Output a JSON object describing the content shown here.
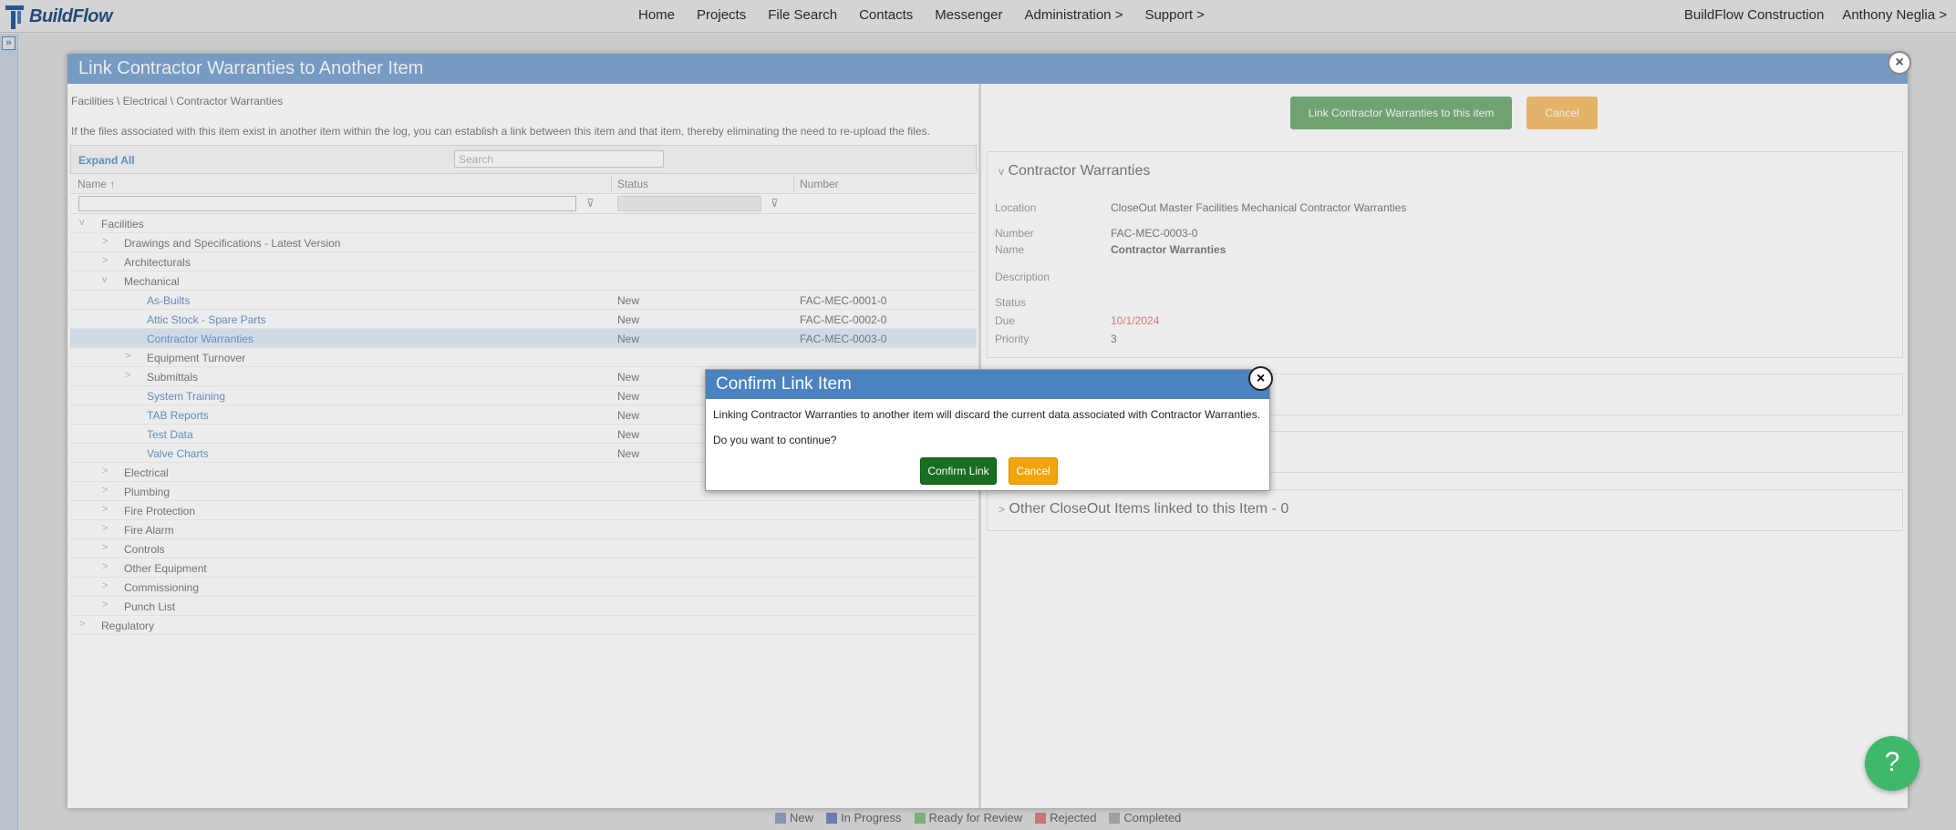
{
  "app": {
    "logo": "BuildFlow"
  },
  "nav": {
    "items": [
      "Home",
      "Projects",
      "File Search",
      "Contacts",
      "Messenger",
      "Administration >",
      "Support >"
    ],
    "company": "BuildFlow Construction",
    "user": "Anthony Neglia >"
  },
  "rail": {
    "toggle": "»"
  },
  "legend": [
    "New",
    "In Progress",
    "Ready for Review",
    "Rejected",
    "Completed"
  ],
  "link_modal": {
    "title": "Link Contractor Warranties to Another Item",
    "close": "×",
    "breadcrumb": "Facilities \\ Electrical \\ Contractor Warranties",
    "info": "If the files associated with this item exist in another item within the log, you can establish a link between this item and that item, thereby eliminating the need to re-upload the files.",
    "expand_all": "Expand All",
    "search_placeholder": "Search",
    "columns": {
      "name": "Name",
      "sort": "↑",
      "status": "Status",
      "number": "Number"
    },
    "filter_icon": "⊽",
    "rows": [
      {
        "chev": "v",
        "name": "Facilities",
        "status": "",
        "number": "",
        "level": 0,
        "leaf": false
      },
      {
        "chev": ">",
        "name": "Drawings and Specifications - Latest Version",
        "status": "",
        "number": "",
        "level": 1,
        "leaf": false
      },
      {
        "chev": ">",
        "name": "Architecturals",
        "status": "",
        "number": "",
        "level": 1,
        "leaf": false
      },
      {
        "chev": "v",
        "name": "Mechanical",
        "status": "",
        "number": "",
        "level": 1,
        "leaf": false
      },
      {
        "chev": "",
        "name": "As-Builts",
        "status": "New",
        "number": "FAC-MEC-0001-0",
        "level": 2,
        "leaf": true
      },
      {
        "chev": "",
        "name": "Attic Stock - Spare Parts",
        "status": "New",
        "number": "FAC-MEC-0002-0",
        "level": 2,
        "leaf": true
      },
      {
        "chev": "",
        "name": "Contractor Warranties",
        "status": "New",
        "number": "FAC-MEC-0003-0",
        "level": 2,
        "leaf": true,
        "selected": true
      },
      {
        "chev": ">",
        "name": "Equipment Turnover",
        "status": "",
        "number": "",
        "level": 2,
        "leaf": false
      },
      {
        "chev": ">",
        "name": "Submittals",
        "status": "New",
        "number": "",
        "level": 2,
        "leaf": false
      },
      {
        "chev": "",
        "name": "System Training",
        "status": "New",
        "number": "",
        "level": 2,
        "leaf": true
      },
      {
        "chev": "",
        "name": "TAB Reports",
        "status": "New",
        "number": "",
        "level": 2,
        "leaf": true
      },
      {
        "chev": "",
        "name": "Test Data",
        "status": "New",
        "number": "",
        "level": 2,
        "leaf": true
      },
      {
        "chev": "",
        "name": "Valve Charts",
        "status": "New",
        "number": "",
        "level": 2,
        "leaf": true
      },
      {
        "chev": ">",
        "name": "Electrical",
        "status": "",
        "number": "",
        "level": 1,
        "leaf": false
      },
      {
        "chev": ">",
        "name": "Plumbing",
        "status": "",
        "number": "",
        "level": 1,
        "leaf": false
      },
      {
        "chev": ">",
        "name": "Fire Protection",
        "status": "",
        "number": "",
        "level": 1,
        "leaf": false
      },
      {
        "chev": ">",
        "name": "Fire Alarm",
        "status": "",
        "number": "",
        "level": 1,
        "leaf": false
      },
      {
        "chev": ">",
        "name": "Controls",
        "status": "",
        "number": "",
        "level": 1,
        "leaf": false
      },
      {
        "chev": ">",
        "name": "Other Equipment",
        "status": "",
        "number": "",
        "level": 1,
        "leaf": false
      },
      {
        "chev": ">",
        "name": "Commissioning",
        "status": "",
        "number": "",
        "level": 1,
        "leaf": false
      },
      {
        "chev": ">",
        "name": "Punch List",
        "status": "",
        "number": "",
        "level": 1,
        "leaf": false
      },
      {
        "chev": ">",
        "name": "Regulatory",
        "status": "",
        "number": "",
        "level": 0,
        "leaf": false
      }
    ],
    "link_button": "Link Contractor Warranties to this item",
    "cancel_button": "Cancel",
    "detail": {
      "title": "Contractor Warranties",
      "chev": "v",
      "location_label": "Location",
      "location": "CloseOut Master Facilities Mechanical Contractor Warranties",
      "number_label": "Number",
      "number": "FAC-MEC-0003-0",
      "name_label": "Name",
      "name": "Contractor Warranties",
      "description_label": "Description",
      "status_label": "Status",
      "due_label": "Due",
      "due": "10/1/2024",
      "priority_label": "Priority",
      "priority": "3"
    },
    "linked_section": {
      "chev": ">",
      "title": "Other CloseOut Items linked to this Item - 0"
    }
  },
  "confirm": {
    "title": "Confirm Link Item",
    "close": "×",
    "message": "Linking Contractor Warranties to another item will discard the current data associated with Contractor Warranties.",
    "question": "Do you want to continue?",
    "confirm_button": "Confirm Link",
    "cancel_button": "Cancel"
  },
  "help": {
    "label": "?"
  },
  "colors": {
    "header_blue": "#4a83bf",
    "confirm_green": "#1a6e22",
    "cancel_orange": "#f4a40b",
    "due_red": "#d9534f",
    "help_green": "#3fb86b"
  }
}
